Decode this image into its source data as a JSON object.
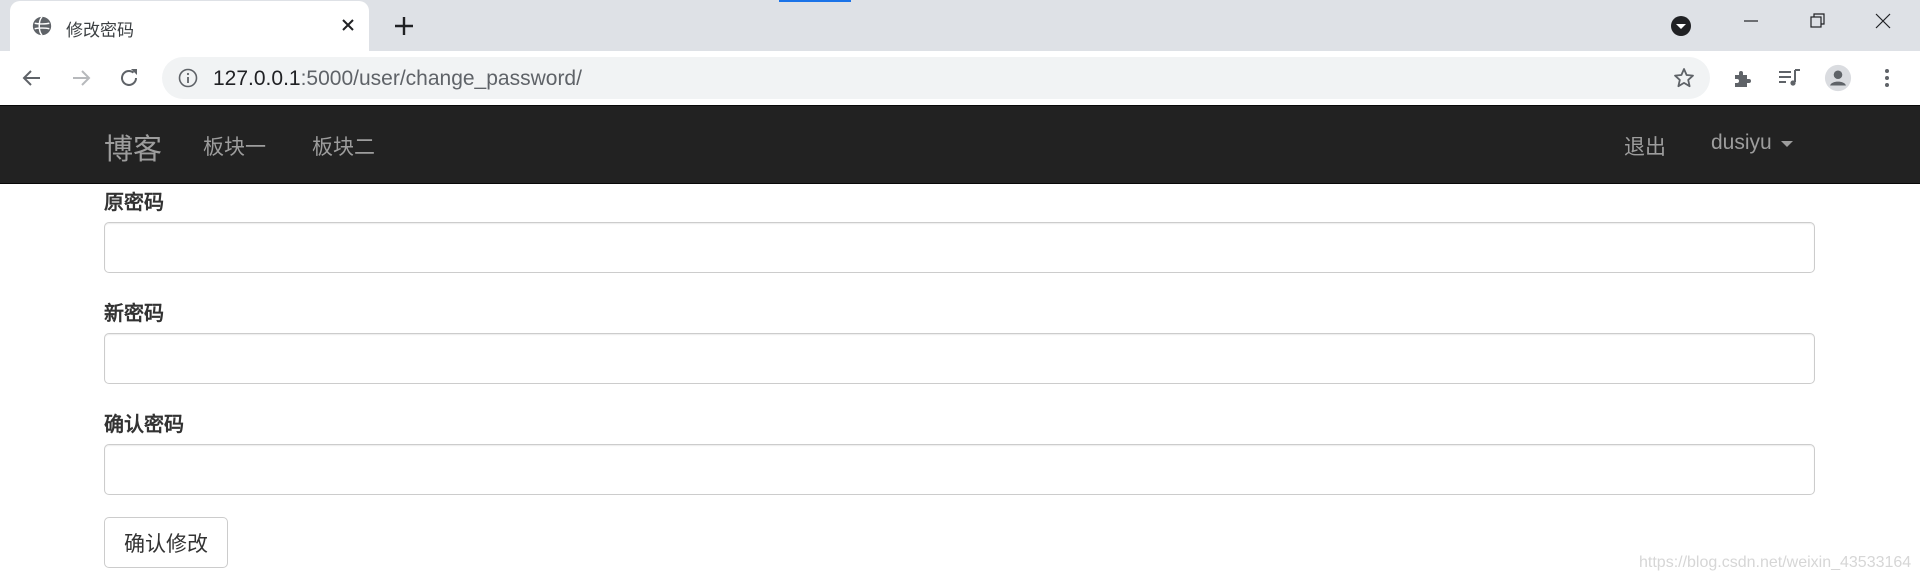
{
  "browser": {
    "tab_title": "修改密码",
    "url_host": "127.0.0.1",
    "url_path": ":5000/user/change_password/",
    "icons": [
      "globe-icon",
      "close-icon",
      "plus-icon",
      "tab-search-icon",
      "minimize-icon",
      "restore-icon",
      "close-window-icon",
      "back-arrow-icon",
      "forward-arrow-icon",
      "reload-icon",
      "info-icon",
      "star-icon",
      "extensions-icon",
      "media-icon",
      "profile-icon",
      "more-vert-icon"
    ]
  },
  "navbar": {
    "brand": "博客",
    "links": [
      {
        "label": "板块一"
      },
      {
        "label": "板块二"
      }
    ],
    "logout": "退出",
    "username": "dusiyu",
    "bg_color": "#222222",
    "text_color": "#9d9d9d"
  },
  "form": {
    "old_password_label": "原密码",
    "old_password_value": "",
    "new_password_label": "新密码",
    "new_password_value": "",
    "confirm_password_label": "确认密码",
    "confirm_password_value": "",
    "submit_label": "确认修改"
  },
  "watermark": "https://blog.csdn.net/weixin_43533164"
}
